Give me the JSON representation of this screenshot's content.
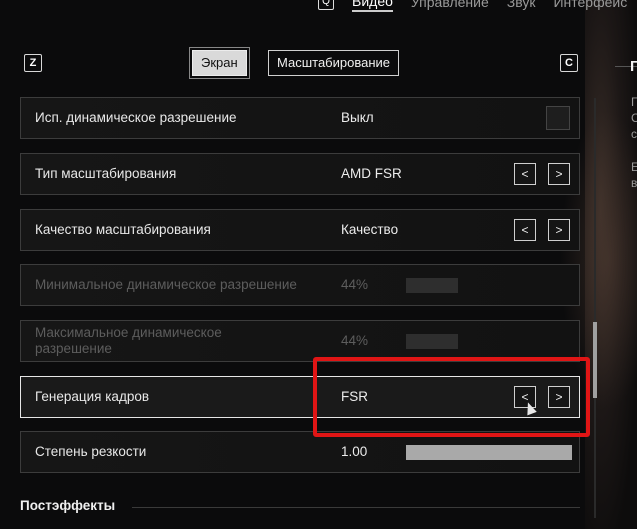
{
  "top_nav": {
    "key_hint": "Q",
    "tabs": [
      {
        "label": "Видео",
        "active": true
      },
      {
        "label": "Управление",
        "active": false
      },
      {
        "label": "Звук",
        "active": false
      },
      {
        "label": "Интерфейс",
        "active": false
      }
    ]
  },
  "sub_tabs": {
    "left_key": "Z",
    "right_key": "C",
    "tabs": [
      {
        "label": "Экран",
        "active": true
      },
      {
        "label": "Масштабирование",
        "active": false
      }
    ]
  },
  "settings": [
    {
      "label": "Исп. динамическое разрешение",
      "value": "Выкл",
      "control": "checkbox",
      "checked": false,
      "enabled": true
    },
    {
      "label": "Тип масштабирования",
      "value": "AMD FSR",
      "control": "arrows",
      "enabled": true
    },
    {
      "label": "Качество масштабирования",
      "value": "Качество",
      "control": "arrows",
      "enabled": true
    },
    {
      "label": "Минимальное динамическое разрешение",
      "value": "44%",
      "control": "slider",
      "level_percent": 44,
      "enabled": false
    },
    {
      "label": "Максимальное динамическое разрешение",
      "value": "44%",
      "control": "slider",
      "level_percent": 44,
      "enabled": false
    },
    {
      "label": "Генерация кадров",
      "value": "FSR",
      "control": "arrows",
      "enabled": true,
      "selected": true
    },
    {
      "label": "Степень резкости",
      "value": "1.00",
      "control": "slider",
      "level_percent": 100,
      "enabled": true
    }
  ],
  "arrows": {
    "prev": "<",
    "next": ">"
  },
  "section_title": "Постэффекты",
  "right_panel": {
    "title": "Г",
    "text_lines": [
      "Г",
      "С",
      "с",
      "Е",
      "в"
    ]
  },
  "colors": {
    "highlight_box": "#e01515",
    "active_tab_bg": "#d9d9d9"
  }
}
